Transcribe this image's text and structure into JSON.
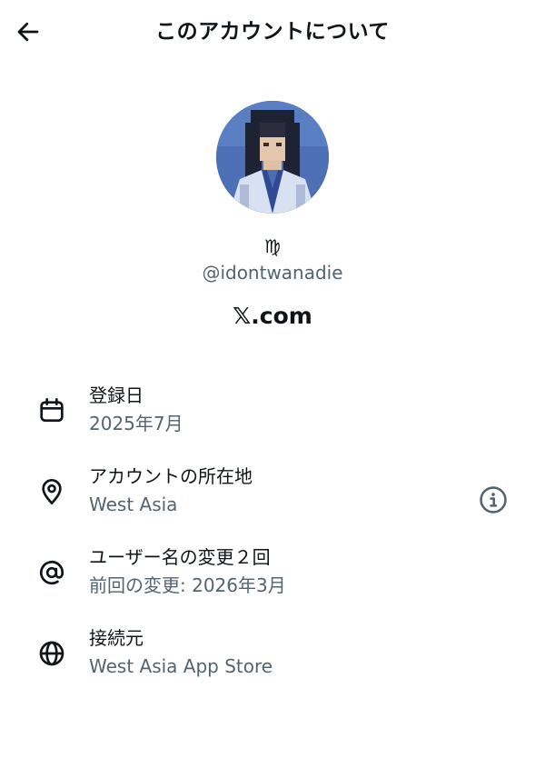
{
  "header": {
    "title": "このアカウントについて",
    "back_icon": "arrow-left-icon"
  },
  "profile": {
    "zodiac_sign": "♍",
    "handle": "@idontwanadie",
    "source_site": "𝕏.com"
  },
  "details": [
    {
      "icon": "calendar-icon",
      "label": "登録日",
      "value": "2025年7月"
    },
    {
      "icon": "location-pin-icon",
      "label": "アカウントの所在地",
      "value": "West Asia",
      "action_icon": "info-icon"
    },
    {
      "icon": "at-sign-icon",
      "label": "ユーザー名の変更２回",
      "value": "前回の変更: 2026年3月"
    },
    {
      "icon": "globe-icon",
      "label": "接続元",
      "value": "West Asia App Store"
    }
  ],
  "colors": {
    "primary_text": "#0f1419",
    "secondary_text": "#536471",
    "background": "#ffffff",
    "avatar_background": "#4c6fb6"
  }
}
